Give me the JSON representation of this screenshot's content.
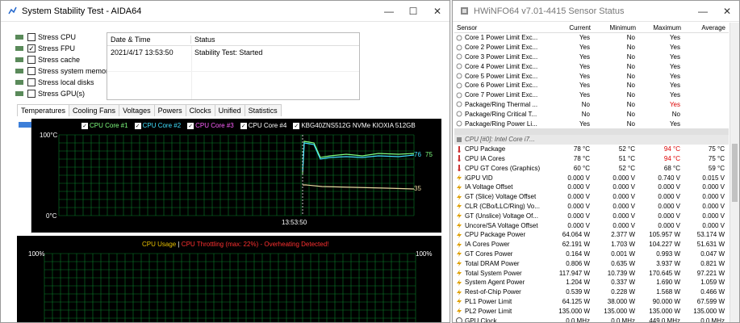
{
  "aida": {
    "title": "System Stability Test - AIDA64",
    "stress_items": [
      {
        "label": "Stress CPU",
        "checked": false,
        "icon": "cpu-icon"
      },
      {
        "label": "Stress FPU",
        "checked": true,
        "icon": "fpu-icon"
      },
      {
        "label": "Stress cache",
        "checked": false,
        "icon": "cache-icon"
      },
      {
        "label": "Stress system memory",
        "checked": false,
        "icon": "memory-icon"
      },
      {
        "label": "Stress local disks",
        "checked": false,
        "icon": "disk-icon"
      },
      {
        "label": "Stress GPU(s)",
        "checked": false,
        "icon": "gpu-icon"
      }
    ],
    "log": {
      "col_datetime": "Date & Time",
      "col_status": "Status",
      "rows": [
        {
          "datetime": "2021/4/17 13:53:50",
          "status": "Stability Test: Started"
        }
      ]
    },
    "tabs": [
      "Temperatures",
      "Cooling Fans",
      "Voltages",
      "Powers",
      "Clocks",
      "Unified",
      "Statistics"
    ],
    "active_tab": "Temperatures",
    "temp_graph": {
      "legend": [
        {
          "label": "CPU Core #1",
          "color": "#7fff7f"
        },
        {
          "label": "CPU Core #2",
          "color": "#40e0ff"
        },
        {
          "label": "CPU Core #3",
          "color": "#ff60ff"
        },
        {
          "label": "CPU Core #4",
          "color": "#ffffff"
        },
        {
          "label": "KBG40ZNS512G NVMe KIOXIA 512GB",
          "color": "#ffffff"
        }
      ],
      "y_top": "100°C",
      "y_bottom": "0°C",
      "x_label": "13:53:50",
      "value_a": "76",
      "value_b": "75",
      "value_c": "35"
    },
    "usage_graph": {
      "label_usage": "CPU Usage",
      "separator": "|",
      "label_throttle": "CPU Throttling (max: 22%) - Overheating Detected!",
      "y_left": "100%",
      "y_right": "100%"
    }
  },
  "hw": {
    "title": "HWiNFO64 v7.01-4415 Sensor Status",
    "columns": [
      "Sensor",
      "Current",
      "Minimum",
      "Maximum",
      "Average"
    ],
    "rows": [
      {
        "name": "Core 1 Power Limit Exc...",
        "cur": "Yes",
        "min": "No",
        "max": "Yes",
        "avg": ""
      },
      {
        "name": "Core 2 Power Limit Exc...",
        "cur": "Yes",
        "min": "No",
        "max": "Yes",
        "avg": ""
      },
      {
        "name": "Core 3 Power Limit Exc...",
        "cur": "Yes",
        "min": "No",
        "max": "Yes",
        "avg": ""
      },
      {
        "name": "Core 4 Power Limit Exc...",
        "cur": "Yes",
        "min": "No",
        "max": "Yes",
        "avg": ""
      },
      {
        "name": "Core 5 Power Limit Exc...",
        "cur": "Yes",
        "min": "No",
        "max": "Yes",
        "avg": ""
      },
      {
        "name": "Core 6 Power Limit Exc...",
        "cur": "Yes",
        "min": "No",
        "max": "Yes",
        "avg": ""
      },
      {
        "name": "Core 7 Power Limit Exc...",
        "cur": "Yes",
        "min": "No",
        "max": "Yes",
        "avg": ""
      },
      {
        "name": "Package/Ring Thermal ...",
        "cur": "No",
        "min": "No",
        "max": "Yes",
        "avg": "",
        "maxred": true
      },
      {
        "name": "Package/Ring Critical T...",
        "cur": "No",
        "min": "No",
        "max": "No",
        "avg": ""
      },
      {
        "name": "Package/Ring Power Li...",
        "cur": "Yes",
        "min": "No",
        "max": "Yes",
        "avg": ""
      }
    ],
    "section": "CPU [#0]: Intel Core i7...",
    "rows2": [
      {
        "name": "CPU Package",
        "cur": "78 °C",
        "min": "52 °C",
        "max": "94 °C",
        "avg": "75 °C",
        "icon": "thermometer-icon",
        "maxred": true
      },
      {
        "name": "CPU IA Cores",
        "cur": "78 °C",
        "min": "51 °C",
        "max": "94 °C",
        "avg": "75 °C",
        "icon": "thermometer-icon",
        "maxred": true
      },
      {
        "name": "CPU GT Cores (Graphics)",
        "cur": "60 °C",
        "min": "52 °C",
        "max": "68 °C",
        "avg": "59 °C",
        "icon": "thermometer-icon"
      },
      {
        "name": "iGPU VID",
        "cur": "0.000 V",
        "min": "0.000 V",
        "max": "0.740 V",
        "avg": "0.015 V",
        "icon": "lightning-icon"
      },
      {
        "name": "IA Voltage Offset",
        "cur": "0.000 V",
        "min": "0.000 V",
        "max": "0.000 V",
        "avg": "0.000 V",
        "icon": "lightning-icon"
      },
      {
        "name": "GT (Slice) Voltage Offset",
        "cur": "0.000 V",
        "min": "0.000 V",
        "max": "0.000 V",
        "avg": "0.000 V",
        "icon": "lightning-icon"
      },
      {
        "name": "CLR (CBo/LLC/Ring) Vo...",
        "cur": "0.000 V",
        "min": "0.000 V",
        "max": "0.000 V",
        "avg": "0.000 V",
        "icon": "lightning-icon"
      },
      {
        "name": "GT (Unslice) Voltage Of...",
        "cur": "0.000 V",
        "min": "0.000 V",
        "max": "0.000 V",
        "avg": "0.000 V",
        "icon": "lightning-icon"
      },
      {
        "name": "Uncore/SA Voltage Offset",
        "cur": "0.000 V",
        "min": "0.000 V",
        "max": "0.000 V",
        "avg": "0.000 V",
        "icon": "lightning-icon"
      },
      {
        "name": "CPU Package Power",
        "cur": "64.064 W",
        "min": "2.377 W",
        "max": "105.957 W",
        "avg": "53.174 W",
        "icon": "lightning-icon"
      },
      {
        "name": "IA Cores Power",
        "cur": "62.191 W",
        "min": "1.703 W",
        "max": "104.227 W",
        "avg": "51.631 W",
        "icon": "lightning-icon"
      },
      {
        "name": "GT Cores Power",
        "cur": "0.164 W",
        "min": "0.001 W",
        "max": "0.993 W",
        "avg": "0.047 W",
        "icon": "lightning-icon"
      },
      {
        "name": "Total DRAM Power",
        "cur": "0.806 W",
        "min": "0.635 W",
        "max": "3.937 W",
        "avg": "0.821 W",
        "icon": "lightning-icon"
      },
      {
        "name": "Total System Power",
        "cur": "117.947 W",
        "min": "10.739 W",
        "max": "170.645 W",
        "avg": "97.221 W",
        "icon": "lightning-icon"
      },
      {
        "name": "System Agent Power",
        "cur": "1.204 W",
        "min": "0.337 W",
        "max": "1.690 W",
        "avg": "1.059 W",
        "icon": "lightning-icon"
      },
      {
        "name": "Rest-of-Chip Power",
        "cur": "0.539 W",
        "min": "0.228 W",
        "max": "1.568 W",
        "avg": "0.466 W",
        "icon": "lightning-icon"
      },
      {
        "name": "PL1 Power Limit",
        "cur": "64.125 W",
        "min": "38.000 W",
        "max": "90.000 W",
        "avg": "67.599 W",
        "icon": "lightning-icon"
      },
      {
        "name": "PL2 Power Limit",
        "cur": "135.000 W",
        "min": "135.000 W",
        "max": "135.000 W",
        "avg": "135.000 W",
        "icon": "lightning-icon"
      },
      {
        "name": "GPU Clock",
        "cur": "0.0 MHz",
        "min": "0.0 MHz",
        "max": "449.0 MHz",
        "avg": "0.0 MHz",
        "icon": "clock-icon"
      }
    ]
  },
  "colors": {
    "grid": "#0a7d2a",
    "core1": "#7fff7f",
    "core2": "#40e0ff",
    "nvme": "#e8d8a0",
    "throttle": "#ff3030",
    "usage": "#e8c000"
  }
}
